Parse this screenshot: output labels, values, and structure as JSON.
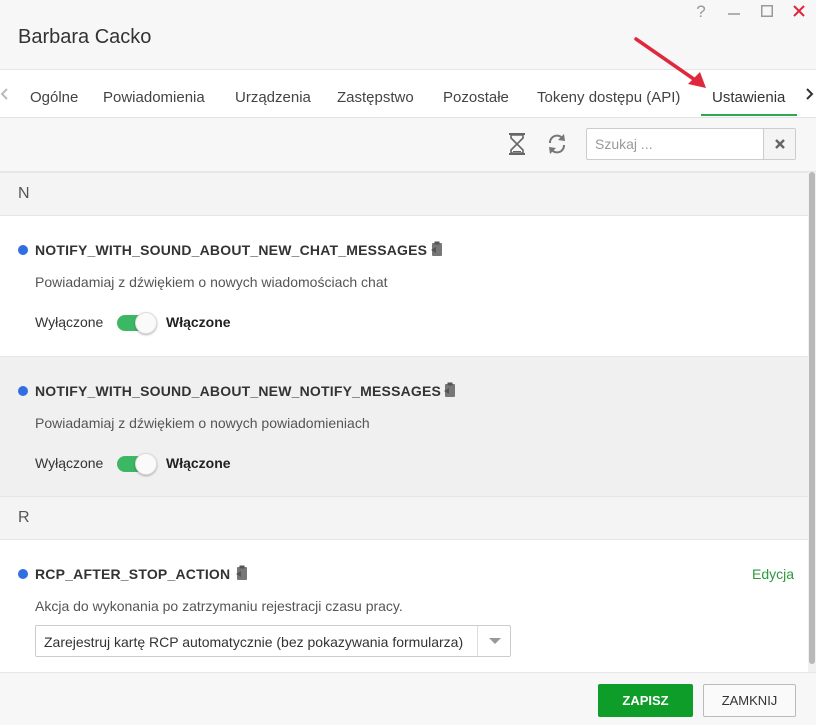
{
  "window": {
    "title": "Barbara Cacko",
    "help_label": "?"
  },
  "tabs": [
    {
      "label": "Ogólne"
    },
    {
      "label": "Powiadomienia"
    },
    {
      "label": "Urządzenia"
    },
    {
      "label": "Zastępstwo"
    },
    {
      "label": "Pozostałe"
    },
    {
      "label": "Tokeny dostępu (API)"
    },
    {
      "label": "Ustawienia",
      "active": true
    }
  ],
  "toolbar": {
    "search_placeholder": "Szukaj ...",
    "search_value": ""
  },
  "groups": [
    {
      "letter": "N",
      "settings": [
        {
          "key": "NOTIFY_WITH_SOUND_ABOUT_NEW_CHAT_MESSAGES",
          "description": "Powiadamiaj z dźwiękiem o nowych wiadomościach chat",
          "off_label": "Wyłączone",
          "on_label": "Włączone",
          "enabled": true
        },
        {
          "key": "NOTIFY_WITH_SOUND_ABOUT_NEW_NOTIFY_MESSAGES",
          "description": "Powiadamiaj z dźwiękiem o nowych powiadomieniach",
          "off_label": "Wyłączone",
          "on_label": "Włączone",
          "enabled": true
        }
      ]
    },
    {
      "letter": "R",
      "settings": [
        {
          "key": "RCP_AFTER_STOP_ACTION",
          "description": "Akcja do wykonania po zatrzymaniu rejestracji czasu pracy.",
          "edit_label": "Edycja",
          "selected_value": "Zarejestruj kartę RCP automatycznie (bez pokazywania formularza)"
        }
      ]
    }
  ],
  "footer": {
    "save_label": "ZAPISZ",
    "close_label": "ZAMKNIJ"
  },
  "colors": {
    "accent_green": "#2fa84f",
    "toggle_on": "#3cb865",
    "save_button": "#0f9d2a",
    "setting_dot": "#2f6fe0",
    "annotation_arrow": "#e0283c"
  },
  "icons": {
    "history": "hourglass-icon",
    "refresh": "refresh-icon",
    "clear": "clear-x-icon",
    "copy": "clipboard-copy-icon",
    "close_window": "close-icon",
    "maximize": "maximize-icon",
    "minimize": "minimize-icon"
  }
}
